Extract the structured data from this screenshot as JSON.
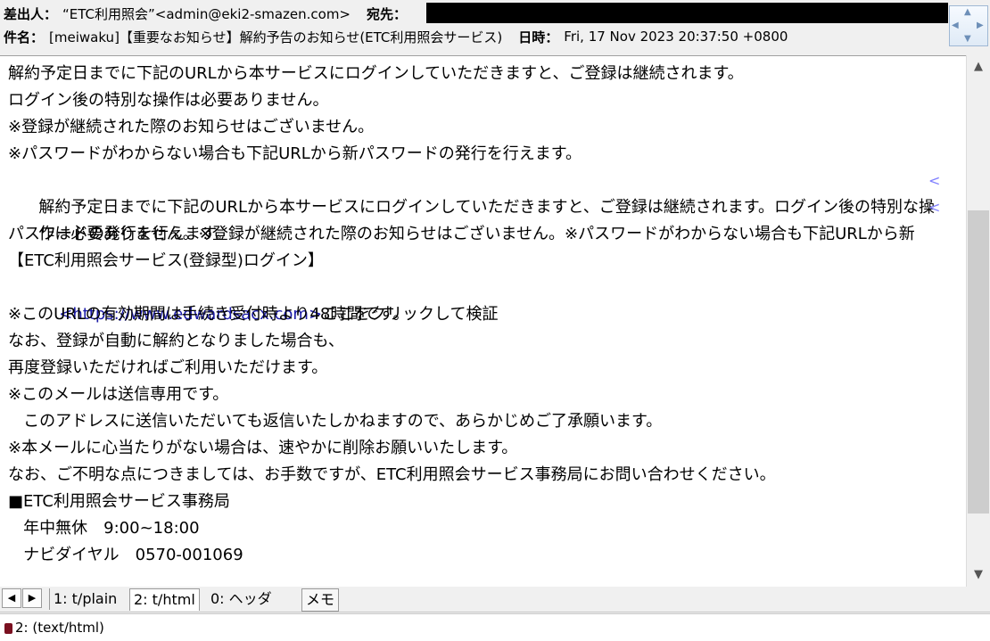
{
  "header": {
    "from_label": "差出人：",
    "from_value": "“ETC利用照会”<admin@eki2-smazen.com>",
    "to_label": "宛先：",
    "subject_label": "件名：",
    "subject_value": "[meiwaku]【重要なお知らせ】解約予告のお知らせ(ETC利用照会サービス)",
    "date_label": "日時：",
    "date_value": "Fri, 17 Nov 2023 20:37:50 +0800"
  },
  "body": {
    "lines": [
      "解約予定日までに下記のURLから本サービスにログインしていただきますと、ご登録は継続されます。",
      "ログイン後の特別な操作は必要ありません。",
      "※登録が継続された際のお知らせはございません。",
      "※パスワードがわからない場合も下記URLから新パスワードの発行を行えます。",
      "解約予定日までに下記のURLから本サービスにログインしていただきますと、ご登録は継続されます。ログイン後の特別な操",
      "作は必要ありません。※登録が継続された際のお知らせはございません。※パスワードがわからない場合も下記URLから新",
      "パスワードの発行を行えます。",
      "【ETC利用照会サービス(登録型)ログイン】",
      "    ",
      "※このURLの有効期間は手続き受付時より48時間です。",
      "なお、登録が自動に解約となりました場合も、",
      "再度登録いただければご利用いただけます。",
      "※このメールは送信専用です。",
      "   このアドレスに送信いただいても返信いたしかねますので、あらかじめご了承願います。",
      "※本メールに心当たりがない場合は、速やかに削除お願いいたします。",
      "なお、ご不明な点につきましては、お手数ですが、ETC利用照会サービス事務局にお問い合わせください。",
      "■ETC利用照会サービス事務局",
      "   年中無休　9:00~18:00",
      "   ナビダイヤル　0570-001069"
    ],
    "link_text": "<https://www.edwardsacx.com>",
    "link_suffix": "ここをクリックして検証",
    "wrap_marker": "<"
  },
  "tabs": {
    "prev": "◀",
    "next": "▶",
    "items": [
      "1: t/plain",
      "2: t/html",
      "0: ヘッダ"
    ],
    "memo": "メモ"
  },
  "status": {
    "text": "2: (text/html)"
  },
  "scroll": {
    "up": "▲",
    "down": "▼",
    "position": 0.35
  },
  "colors": {
    "link": "#1a1aa6",
    "wrap_marker": "#8080ff"
  }
}
